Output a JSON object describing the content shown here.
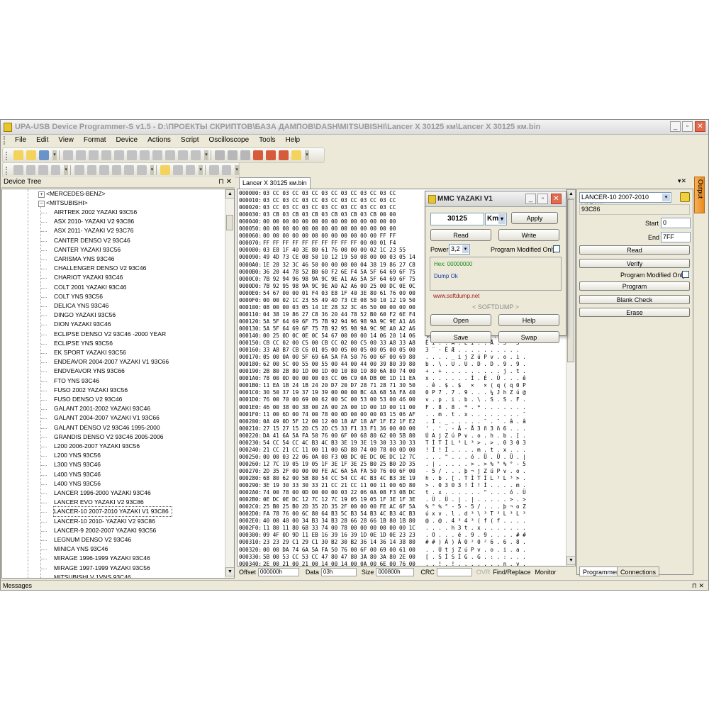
{
  "window": {
    "title": "UPA-USB Device Programmer-S v1.5 - D:\\ПРОЕКТЫ СКРИПТОВ\\БАЗА ДАМПОВ\\DASH\\MITSUBISHI\\Lancer X 30125 км\\Lancer X 30125 км.bin",
    "minimize": "_",
    "maximize": "▫",
    "close": "✕"
  },
  "menu": [
    "File",
    "Edit",
    "View",
    "Format",
    "Device",
    "Actions",
    "Script",
    "Oscilloscope",
    "Tools",
    "Help"
  ],
  "device_tree": {
    "header": "Device Tree",
    "pin": "⊓ ✕",
    "parents": [
      {
        "label": "<MERCEDES-BENZ>",
        "expander": "+"
      },
      {
        "label": "<MITSUBISHI>",
        "expander": "−"
      }
    ],
    "items": [
      "AIRTREK 2002 YAZAKI 93C56",
      "ASX 2010- YAZAKI V2 93C86",
      "ASX 2011- YAZAKI V2 93C76",
      "CANTER DENSO V2 93C46",
      "CANTER YAZAKI 93C56",
      "CARISMA YNS 93C46",
      "CHALLENGER DENSO V2 93C46",
      "CHARIOT YAZAKI 93C46",
      "COLT 2001 YAZAKI 93C46",
      "COLT YNS 93C56",
      "DELICA YNS 93C46",
      "DINGO YAZAKI 93C56",
      "DION YAZAKI 93C46",
      "ECLIPSE DENSO V2 93C46 -2000 YEAR",
      "ECLIPSE YNS 93C56",
      "EK SPORT YAZAKI 93C56",
      "ENDEAVOR 2004-2007 YAZAKI V1 93C66",
      "ENDVEAVOR YNS 93C66",
      "FTO YNS 93C46",
      "FUSO 2002 YAZAKI 93C56",
      "FUSO DENSO V2 93C46",
      "GALANT 2001-2002 YAZAKI 93C46",
      "GALANT 2004-2007 YAZAKI V1 93C66",
      "GALANT DENSO V2 93C46 1995-2000",
      "GRANDIS DENSO V2 93C46 2005-2006",
      "L200 2006-2007 YAZAKI 93C56",
      "L200 YNS 93C56",
      "L300 YNS 93C46",
      "L400 YNS 93C46",
      "L400 YNS 93C56",
      "LANCER 1996-2000 YAZAKI 93C46",
      "LANCER EVO YAZAKI V2 93C86",
      "LANCER-10 2007-2010 YAZAKI V1 93C86",
      "LANCER-10 2010- YAZAKI V2 93C86",
      "LANCER-9 2002-2007 YAZAKI 93C56",
      "LEGNUM DENSO V2 93C46",
      "MINICA YNS 93C46",
      "MIRAGE 1996-1999 YAZAKI 93C46",
      "MIRAGE 1997-1999 YAZAKI 93C56",
      "MITSUBISHI V 1VNS 93C46"
    ],
    "selected_index": 32
  },
  "doc_tab": "Lancer X 30125 км.bin",
  "hex_lines": [
    {
      "a": "000000:",
      "h": "03 CC 03 CC 03 CC 03 CC 03 CC 03 CC 03 CC",
      "s": ""
    },
    {
      "a": "000010:",
      "h": "03 CC 03 CC 03 CC 03 CC 03 CC 03 CC 03 CC",
      "s": ""
    },
    {
      "a": "000020:",
      "h": "03 CC 03 CC 03 CC 03 CC 03 CC 03 CC 03 CC",
      "s": ""
    },
    {
      "a": "000030:",
      "h": "03 CB 03 CB 03 CB 03 CB 03 CB 03 CB 00 00",
      "s": ""
    },
    {
      "a": "000040:",
      "h": "00 00 00 00 00 00 00 00 00 00 00 00 00 00",
      "s": ""
    },
    {
      "a": "000050:",
      "h": "00 00 00 00 00 00 00 00 00 00 00 00 00 00",
      "s": ""
    },
    {
      "a": "000060:",
      "h": "00 00 00 00 00 00 00 00 00 00 00 00 FF FF",
      "s": ""
    },
    {
      "a": "000070:",
      "h": "FF FF FF FF FF FF FF FF FF FF 00 00 01 F4",
      "s": ""
    },
    {
      "a": "000080:",
      "h": "03 E8 1F 40 3E 80 61 76 00 00 00 02 1C 23 55",
      "s": ""
    },
    {
      "a": "000090:",
      "h": "49 4D 73 CE 08 50 10 12 19 50 08 00 00 03 05 14",
      "s": ""
    },
    {
      "a": "0000A0:",
      "h": "1E 28 32 3C 46 50 00 00 00 00 04 38 19 86 27 C8",
      "s": ""
    },
    {
      "a": "0000B0:",
      "h": "36 20 44 78 52 B0 60 F2 6E F4 5A 5F 64 69 6F 75",
      "s": ""
    },
    {
      "a": "0000C0:",
      "h": "7B 92 94 96 98 9A 9C 9E A1 A6 5A 5F 64 69 6F 75",
      "s": ""
    },
    {
      "a": "0000D0:",
      "h": "7B 92 95 98 9A 9C 9E A0 A2 A6 00 25 00 DC 0E 0C",
      "s": ""
    },
    {
      "a": "0000E0:",
      "h": "54 67 00 00 01 F4 03 E8 1F 40 3E 80 61 76 00 00",
      "s": ""
    },
    {
      "a": "0000F0:",
      "h": "00 00 02 1C 23 55 49 4D 73 CE 08 50 10 12 19 50",
      "s": ""
    },
    {
      "a": "000100:",
      "h": "08 00 00 03 05 14 1E 28 32 3C 46 50 00 00 00 00",
      "s": ""
    },
    {
      "a": "000110:",
      "h": "04 38 19 86 27 C8 36 20 44 78 52 B0 60 F2 6E F4",
      "s": ""
    },
    {
      "a": "000120:",
      "h": "5A 5F 64 69 6F 75 7B 92 94 96 98 9A 9C 9E A1 A6",
      "s": ""
    },
    {
      "a": "000130:",
      "h": "5A 5F 64 69 6F 75 7B 92 95 98 9A 9C 9E A0 A2 A6",
      "s": ""
    },
    {
      "a": "000140:",
      "h": "00 25 0D 0C 0E 0C 54 67 00 00 00 14 06 20 14 06",
      "s": "%. . . . T g . . . . . . ."
    },
    {
      "a": "000150:",
      "h": "CB CC 02 00 C5 00 CB CC 02 00 C5 00 33 A8 33 A8",
      "s": "Ë Ì . . Å . Ë Ì . . Å . 3 ¨ 3 ¨"
    },
    {
      "a": "000160:",
      "h": "33 A8 B7 CB C6 01 05 00 05 00 05 00 05 00 05 00",
      "s": "3 ¨ · Ë Æ . . . . . . . . . ."
    },
    {
      "a": "000170:",
      "h": "05 00 0A 00 5F 69 6A 5A FA 50 76 00 6F 00 69 80",
      "s": ". . . . _ i j Z ú P v . o . i ."
    },
    {
      "a": "000180:",
      "h": "62 00 5C 00 55 00 55 00 44 00 44 00 39 80 39 80",
      "s": "b . \\ . U . U . D . D . 9 . 9 ."
    },
    {
      "a": "000190:",
      "h": "2B 80 2B 80 1D 00 1D 00 10 80 10 80 6A 80 74 00",
      "s": "+ . + . . . . . . . . . j . t ."
    },
    {
      "a": "0001A0:",
      "h": "78 00 0D 00 00 00 03 CC 06 C9 0A DB 0E 1D 11 EA",
      "s": "x . . . . . . Ì . É . Û . . . ê"
    },
    {
      "a": "0001B0:",
      "h": "11 EA 1B 24 1B 24 20 D7 20 D7 28 71 28 71 30 50",
      "s": ". ê . $ . $   ×   × ( q ( q 0 P"
    },
    {
      "a": "0001C0:",
      "h": "30 50 37 19 37 19 39 00 00 00 BC 4A 68 5A FA 40",
      "s": "0 P 7 . 7 . 9 . . . ¼ J h Z ú @"
    },
    {
      "a": "0001D0:",
      "h": "76 00 70 00 69 00 62 00 5C 00 53 00 53 00 46 00",
      "s": "v . p . i . b . \\ . S . S . F ."
    },
    {
      "a": "0001E0:",
      "h": "46 00 38 00 38 00 2A 00 2A 00 1D 00 1D 00 11 00",
      "s": "F . 8 . 8 . * . * . . . . . . ."
    },
    {
      "a": "0001F0:",
      "h": "11 00 6D 00 74 00 78 00 0D 00 00 00 03 15 06 AF",
      "s": ". . m . t . x . . . . . . . . ¯"
    },
    {
      "a": "000200:",
      "h": "0A 49 0D 5F 12 00 12 00 18 AF 18 AF 1F E2 1F E2",
      "s": ". I . _ . . . . . ¯ . ¯ . â . â"
    },
    {
      "a": "000210:",
      "h": "27 15 27 15 2D C5 2D C5 33 F1 33 F1 36 00 00 00",
      "s": "' . ' . - Å - Å 3 ñ 3 ñ 6 . . ."
    },
    {
      "a": "000220:",
      "h": "DA 41 6A 5A FA 50 76 00 6F 00 68 80 62 00 5B 80",
      "s": "Ú A j Z ú P v . o . h . b . [ ."
    },
    {
      "a": "000230:",
      "h": "54 CC 54 CC 4C B3 4C B3 3E 19 3E 19 30 33 30 33",
      "s": "T Ì T Ì L ³ L ³ > . > . 0 3 0 3"
    },
    {
      "a": "000240:",
      "h": "21 CC 21 CC 11 00 11 00 6D 80 74 00 78 00 0D 00",
      "s": "! Ì ! Ì . . . . m . t . x . . ."
    },
    {
      "a": "000250:",
      "h": "00 00 03 22 06 0A 08 F3 0B DC 0E DC 0E DC 12 7C",
      "s": ". . . \" . . . ó . Ü . Ü . Ü . |"
    },
    {
      "a": "000260:",
      "h": "12 7C 19 05 19 05 1F 3E 1F 3E 25 B0 25 B0 2D 35",
      "s": ". | . . . . . > . > % ° % ° - 5"
    },
    {
      "a": "000270:",
      "h": "2D 35 2F 00 00 00 FE AC 6A 5A FA 50 76 00 6F 00",
      "s": "- 5 / . . . þ ¬ j Z ú P v . o ."
    },
    {
      "a": "000280:",
      "h": "68 80 62 00 5B 80 54 CC 54 CC 4C B3 4C B3 3E 19",
      "s": "h . b . [ . T Ì T Ì L ³ L ³ > ."
    },
    {
      "a": "000290:",
      "h": "3E 19 30 33 30 33 21 CC 21 CC 11 00 11 00 6D 80",
      "s": "> . 0 3 0 3 ! Ì ! Ì . . . . m ."
    },
    {
      "a": "0002A0:",
      "h": "74 00 78 00 0D 00 00 00 03 22 06 0A 08 F3 0B DC",
      "s": "t . x . . . . . . \" . . . ó . Ü"
    },
    {
      "a": "0002B0:",
      "h": "0E DC 0E DC 12 7C 12 7C 19 05 19 05 1F 3E 1F 3E",
      "s": ". Ü . Ü . | . | . . . . . > . >"
    },
    {
      "a": "0002C0:",
      "h": "25 B0 25 B0 2D 35 2D 35 2F 00 00 00 FE AC 6F 5A",
      "s": "% ° % ° - 5 - 5 / . . . þ ¬ o Z"
    },
    {
      "a": "0002D0:",
      "h": "FA 78 76 00 6C 80 64 B3 5C B3 54 B3 4C B3 4C B3",
      "s": "ú x v . l . d ³ \\ ³ T ³ L ³ L ³"
    },
    {
      "a": "0002E0:",
      "h": "40 00 40 00 34 B3 34 B3 28 66 28 66 1B 80 1B 80",
      "s": "@ . @ . 4 ³ 4 ³ ( f ( f . . . ."
    },
    {
      "a": "0002F0:",
      "h": "11 80 11 80 68 33 74 00 78 00 00 00 00 00 00 1C",
      "s": ". . . . h 3 t . x . . . . . . ."
    },
    {
      "a": "000300:",
      "h": "09 4F 0D 9D 11 EB 16 39 16 39 1D 0E 1D 0E 23 23",
      "s": ". O . . . ë . 9 . 9 . . . . # #"
    },
    {
      "a": "000310:",
      "h": "23 23 29 C1 29 C1 30 B2 30 B2 36 14 36 14 38 80",
      "s": "# # ) Á ) Á 0 ² 0 ² 6 . 6 . 8 ."
    },
    {
      "a": "000320:",
      "h": "00 00 DA 74 6A 5A FA 50 76 00 6F 00 69 00 61 00",
      "s": ". . Ú t j Z ú P v . o . i . a ."
    },
    {
      "a": "000330:",
      "h": "5B 00 53 CC 53 CC 47 80 47 80 3A 80 3A 80 2E 00",
      "s": "[ . S Ì S Ì G . G . : . : . . ."
    },
    {
      "a": "000340:",
      "h": "2E 00 21 00 21 00 14 00 14 00 0A 00 6E 00 76 00",
      "s": ". . ! . ! . . . . . . . n . v ."
    }
  ],
  "hex_status": {
    "offset_label": "Offset",
    "offset_value": "000000h",
    "data_label": "Data",
    "data_value": "03h",
    "size_label": "Size",
    "size_value": "000800h",
    "crc_label": "CRC",
    "ovr": "OVR",
    "find_replace": "Find/Replace",
    "monitor": "Monitor"
  },
  "dialog": {
    "title": "MMC YAZAKI V1",
    "km_value": "30125",
    "km_unit": "Km",
    "apply": "Apply",
    "read": "Read",
    "write": "Write",
    "power_label": "Power",
    "power_value": "3,2",
    "program_modified_only": "Program Modified Only",
    "hex_line": "Hex: 00000000",
    "dump_status": "Dump Ok",
    "website": "www.softdump.net",
    "brand": "< SOFTDUMP >",
    "open": "Open",
    "help": "Help",
    "save": "Save",
    "swap": "Swap",
    "colors": {
      "hex": "#1a8a1a",
      "dump": "#1a3aa8",
      "site": "#a01818"
    }
  },
  "right_panel": {
    "device_select": "LANCER-10 2007-2010 YAZAKI",
    "chip": "93C86",
    "start_label": "Start",
    "start_value": "0",
    "end_label": "End",
    "end_value": "7FF",
    "read": "Read",
    "verify": "Verify",
    "program_modified_only": "Program Modified Only",
    "program": "Program",
    "blank_check": "Blank Check",
    "erase": "Erase",
    "tab_programmer": "Programmer",
    "tab_connections": "Connections",
    "output_tab": "Output"
  },
  "messages": "Messages"
}
